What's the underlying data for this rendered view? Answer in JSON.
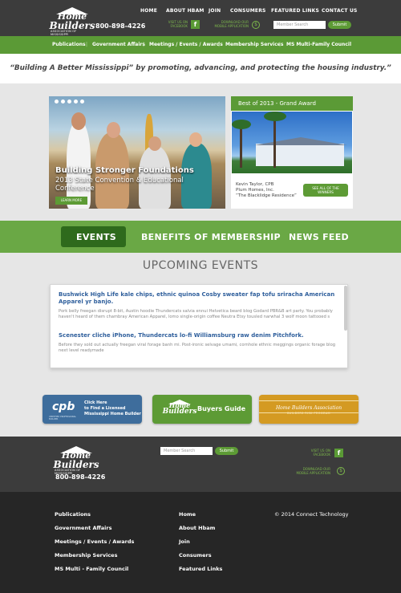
{
  "header": {
    "logo": {
      "line1": "Home",
      "line2": "Builders",
      "line3": "ASSOCIATION OF MISSISSIPPI"
    },
    "phone": "800-898-4226",
    "nav": [
      "HOME",
      "ABOUT HBAM",
      "JOIN",
      "CONSUMERS",
      "FEATURED LINKS",
      "CONTACT US"
    ],
    "facebook_label_1": "VISIT US ON",
    "facebook_label_2": "FACEBOOK",
    "mobile_label_1": "DOWNLOAD OUR",
    "mobile_label_2": "MOBILE APPLICATION",
    "search_placeholder": "Member Search",
    "submit_label": "Submit"
  },
  "subnav": [
    "Publications",
    "Government Affairs",
    "Meetings / Events / Awards",
    "Membership Services",
    "MS Multi-Family Council"
  ],
  "tagline": "“Building A Better Mississippi” by promoting, advancing, and protecting the housing industry.”",
  "slider": {
    "title": "Building Stronger Foundations",
    "subtitle": "2013 State Convention & Educational Conference",
    "button": "LEARN MORE"
  },
  "award": {
    "header": "Best of 2013 - Grand Award",
    "caption_1": "Kevin Taylor, CPB",
    "caption_2": "Plum Homes, Inc.",
    "caption_3": "“The Blacklidge Residence”",
    "button_1": "SEE ALL OF THE",
    "button_2": "WINNERS"
  },
  "tabs": [
    "EVENTS",
    "BENEFITS OF MEMBERSHIP",
    "NEWS FEED"
  ],
  "events": {
    "title": "UPCOMING EVENTS",
    "items": [
      {
        "title": "Bushwick High Life kale chips, ethnic quinoa Cosby sweater fap tofu sriracha American Apparel yr banjo.",
        "body": "Pork belly freegan disrupt 8-bit, Austin hoodie Thundercats salvia ennui Helvetica beard blog Godard PBR&B art party. You probably haven't heard of them chambray American Apparel, lomo single-origin coffee Neutra Etsy tousled narwhal 3 wolf moon tattooed s"
      },
      {
        "title": "Scenester cliche iPhone, Thundercats lo-fi Williamsburg raw denim Pitchfork.",
        "body": "Before they sold out actually freegan viral forage banh mi. Post-ironic selvage umami, cornhole ethnic meggings organic forage blog next level readymade"
      }
    ]
  },
  "buttons": {
    "cpb": {
      "logo": "cpb",
      "logo_sub": "CERTIFIED PROFESSIONAL BUILDER",
      "text_1": "Click Here",
      "text_2": "to Find a Licensed",
      "text_3": "Mississippi Home Builder",
      "color": "#3e6d9c"
    },
    "buyers": {
      "text": "Buyers Guide",
      "color": "#5d9b35"
    },
    "risk": {
      "line1": "Home Builders Association",
      "line2": "BUILDERS RISK PROGRAM",
      "color": "#d49a22"
    }
  },
  "footer": {
    "phone": "800-898-4226",
    "search_placeholder": "Member Search",
    "submit_label": "Submit",
    "facebook_label_1": "VISIT US ON",
    "facebook_label_2": "FACEBOOK",
    "mobile_label_1": "DOWNLOAD OUR",
    "mobile_label_2": "MOBILE APPLICATION",
    "col1": [
      "Publications",
      "Government Affairs",
      "Meetings / Events / Awards",
      "Membership Services",
      "MS Multi - Family Council"
    ],
    "col2": [
      "Home",
      "About Hbam",
      "Join",
      "Consumers",
      "Featured Links"
    ],
    "copyright": "© 2014 Connect Technology"
  },
  "colors": {
    "accent_green": "#5b9a36",
    "dark_green": "#2e6a1c",
    "header_dark": "#3c3c3c",
    "footer_dark": "#262626",
    "link_blue": "#2f5f9c"
  }
}
